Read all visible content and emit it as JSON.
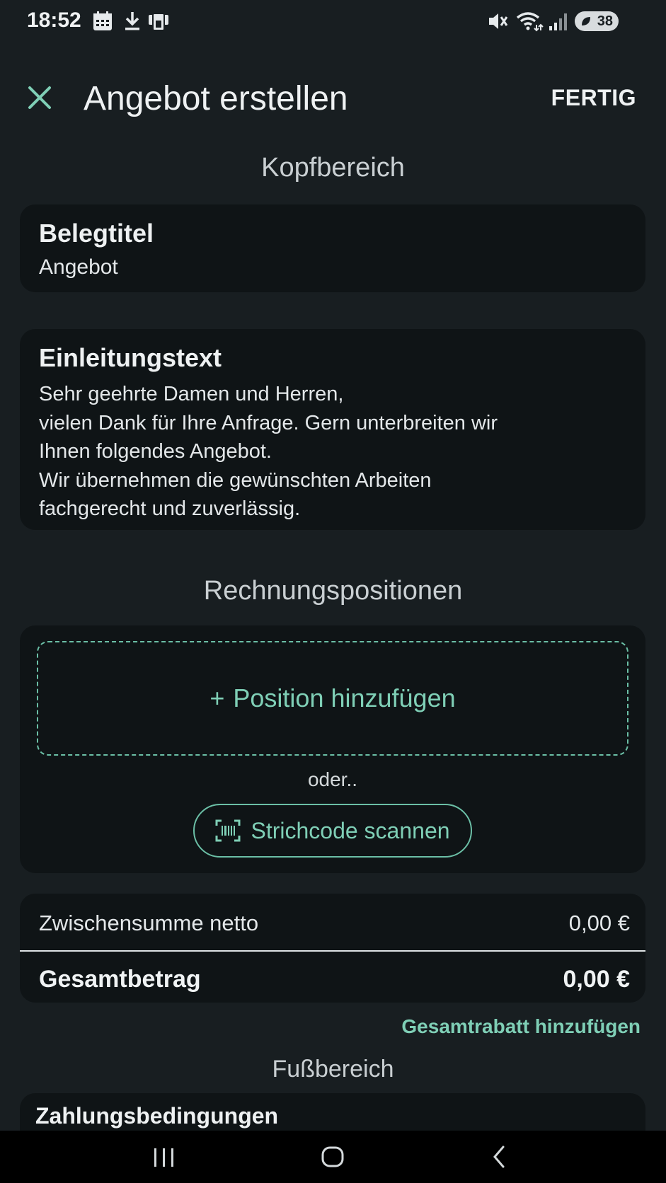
{
  "status_bar": {
    "time": "18:52",
    "left_icons": [
      "calendar-icon",
      "download-icon",
      "nfc-card-icon"
    ],
    "right_icons": [
      "mute-icon",
      "wifi-icon",
      "signal-icon"
    ],
    "battery": "38"
  },
  "app_bar": {
    "title": "Angebot erstellen",
    "done_label": "FERTIG",
    "close_icon": "close-icon"
  },
  "header_section": {
    "heading": "Kopfbereich",
    "doc_title_label": "Belegtitel",
    "doc_title_value": "Angebot",
    "intro_label": "Einleitungstext",
    "intro_lines": [
      "Sehr geehrte Damen und Herren,",
      "vielen Dank für Ihre Anfrage. Gern unterbreiten wir",
      "Ihnen folgendes Angebot.",
      "Wir übernehmen die gewünschten Arbeiten",
      "fachgerecht und zuverlässig."
    ]
  },
  "positions_section": {
    "heading": "Rechnungspositionen",
    "add_position_plus": "+",
    "add_position_label": "Position hinzufügen",
    "or_text": "oder..",
    "scan_label": "Strichcode scannen"
  },
  "totals": {
    "subtotal_label": "Zwischensumme netto",
    "subtotal_value": "0,00 €",
    "grand_total_label": "Gesamtbetrag",
    "grand_total_value": "0,00 €",
    "discount_link": "Gesamtrabatt hinzufügen"
  },
  "footer_section": {
    "heading": "Fußbereich",
    "payment_terms_label": "Zahlungsbedingungen"
  },
  "colors": {
    "background": "#181e21",
    "card": "#0f1416",
    "accent": "#7fcfb6"
  }
}
